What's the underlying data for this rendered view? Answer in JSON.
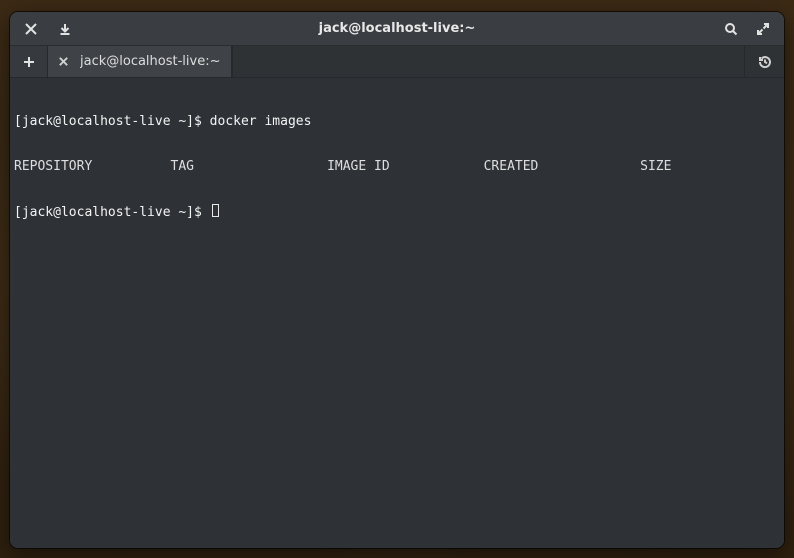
{
  "window": {
    "title": "jack@localhost-live:~"
  },
  "tabs": {
    "items": [
      {
        "title": "jack@localhost-live:~"
      }
    ]
  },
  "terminal": {
    "prompt1_host": "[jack@localhost-live ~]$ ",
    "command1": "docker images",
    "columns_line": "REPOSITORY          TAG                 IMAGE ID            CREATED             SIZE",
    "prompt2_host": "[jack@localhost-live ~]$ "
  }
}
